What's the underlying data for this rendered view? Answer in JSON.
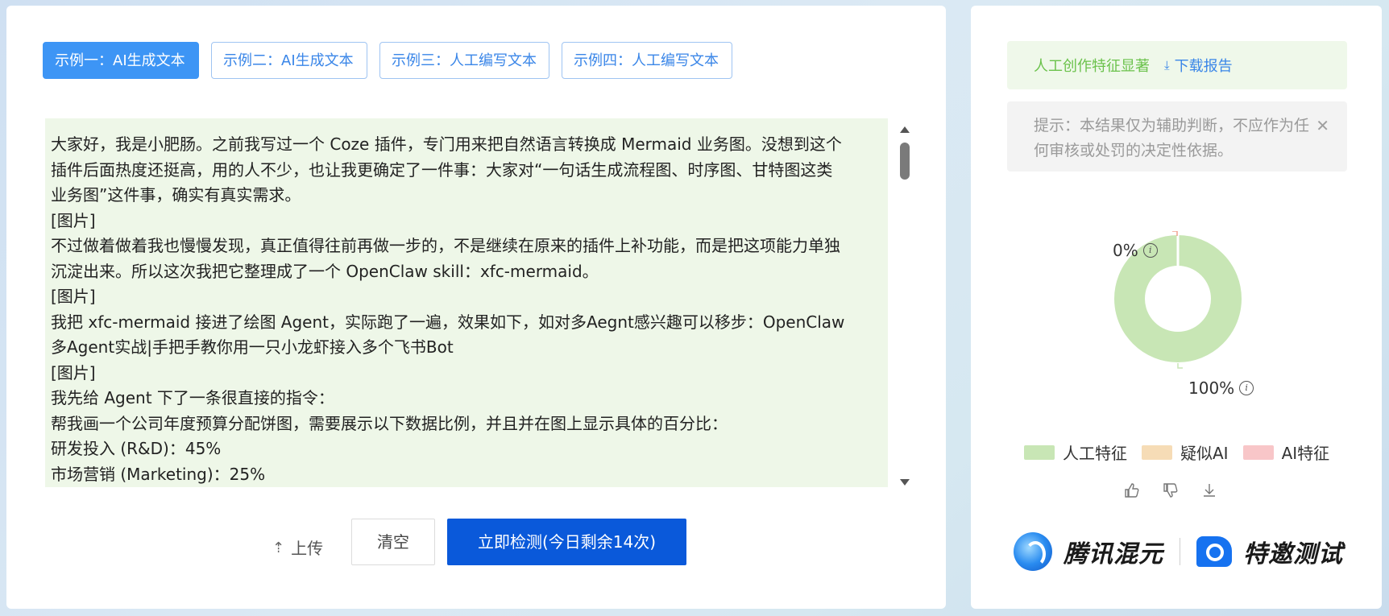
{
  "tabs": [
    {
      "label": "示例一：AI生成文本",
      "active": true
    },
    {
      "label": "示例二：AI生成文本",
      "active": false
    },
    {
      "label": "示例三：人工编写文本",
      "active": false
    },
    {
      "label": "示例四：人工编写文本",
      "active": false
    }
  ],
  "text_lines": [
    "大家好，我是小肥肠。之前我写过一个 Coze 插件，专门用来把自然语言转换成 Mermaid 业务图。没想到这个",
    "插件后面热度还挺高，用的人不少，也让我更确定了一件事：大家对“一句话生成流程图、时序图、甘特图这类",
    "业务图”这件事，确实有真实需求。",
    "[图片]",
    "不过做着做着我也慢慢发现，真正值得往前再做一步的，不是继续在原来的插件上补功能，而是把这项能力单独",
    "沉淀出来。所以这次我把它整理成了一个 OpenClaw skill：xfc-mermaid。",
    "[图片]",
    "我把 xfc-mermaid 接进了绘图 Agent，实际跑了一遍，效果如下，如对多Aegnt感兴趣可以移步：OpenClaw",
    "多Agent实战|手把手教你用一只小龙虾接入多个飞书Bot",
    "[图片]",
    "我先给 Agent 下了一条很直接的指令：",
    "帮我画一个公司年度预算分配饼图，需要展示以下数据比例，并且并在图上显示具体的百分比：",
    "研发投入 (R&D)：45%",
    "市场营销 (Marketing)：25%"
  ],
  "actions": {
    "upload_label": "上传",
    "clear_label": "清空",
    "detect_label": "立即检测(今日剩余14次)"
  },
  "result": {
    "summary": "人工创作特征显著",
    "download_label": "下载报告",
    "tip": "提示：本结果仅为辅助判断，不应作为任何审核或处罚的决定性依据。"
  },
  "donut": {
    "top_label": "0%",
    "bottom_label": "100%",
    "human_fraction": 1.0,
    "suspected_ai_fraction": 0.0,
    "ai_fraction": 0.0
  },
  "legend": [
    {
      "label": "人工特征",
      "color": "#c8e6b5"
    },
    {
      "label": "疑似AI",
      "color": "#f6dcb6"
    },
    {
      "label": "AI特征",
      "color": "#f8c6c8"
    }
  ],
  "feedback_icons": [
    "thumbs-up-icon",
    "thumbs-down-icon",
    "download-icon"
  ],
  "brand": {
    "name": "腾讯混元",
    "invite": "特邀测试"
  },
  "colors": {
    "accent": "#3d95f5",
    "primary_button": "#0a59da",
    "human": "#c8e6b5",
    "success_text": "#6bc24c"
  }
}
